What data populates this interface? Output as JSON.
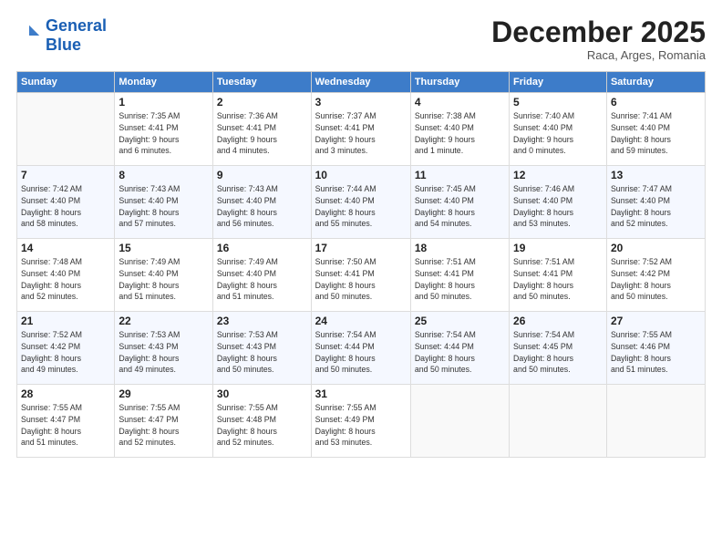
{
  "header": {
    "logo_line1": "General",
    "logo_line2": "Blue",
    "month": "December 2025",
    "location": "Raca, Arges, Romania"
  },
  "days_header": [
    "Sunday",
    "Monday",
    "Tuesday",
    "Wednesday",
    "Thursday",
    "Friday",
    "Saturday"
  ],
  "weeks": [
    [
      {
        "day": "",
        "info": ""
      },
      {
        "day": "1",
        "info": "Sunrise: 7:35 AM\nSunset: 4:41 PM\nDaylight: 9 hours\nand 6 minutes."
      },
      {
        "day": "2",
        "info": "Sunrise: 7:36 AM\nSunset: 4:41 PM\nDaylight: 9 hours\nand 4 minutes."
      },
      {
        "day": "3",
        "info": "Sunrise: 7:37 AM\nSunset: 4:41 PM\nDaylight: 9 hours\nand 3 minutes."
      },
      {
        "day": "4",
        "info": "Sunrise: 7:38 AM\nSunset: 4:40 PM\nDaylight: 9 hours\nand 1 minute."
      },
      {
        "day": "5",
        "info": "Sunrise: 7:40 AM\nSunset: 4:40 PM\nDaylight: 9 hours\nand 0 minutes."
      },
      {
        "day": "6",
        "info": "Sunrise: 7:41 AM\nSunset: 4:40 PM\nDaylight: 8 hours\nand 59 minutes."
      }
    ],
    [
      {
        "day": "7",
        "info": "Sunrise: 7:42 AM\nSunset: 4:40 PM\nDaylight: 8 hours\nand 58 minutes."
      },
      {
        "day": "8",
        "info": "Sunrise: 7:43 AM\nSunset: 4:40 PM\nDaylight: 8 hours\nand 57 minutes."
      },
      {
        "day": "9",
        "info": "Sunrise: 7:43 AM\nSunset: 4:40 PM\nDaylight: 8 hours\nand 56 minutes."
      },
      {
        "day": "10",
        "info": "Sunrise: 7:44 AM\nSunset: 4:40 PM\nDaylight: 8 hours\nand 55 minutes."
      },
      {
        "day": "11",
        "info": "Sunrise: 7:45 AM\nSunset: 4:40 PM\nDaylight: 8 hours\nand 54 minutes."
      },
      {
        "day": "12",
        "info": "Sunrise: 7:46 AM\nSunset: 4:40 PM\nDaylight: 8 hours\nand 53 minutes."
      },
      {
        "day": "13",
        "info": "Sunrise: 7:47 AM\nSunset: 4:40 PM\nDaylight: 8 hours\nand 52 minutes."
      }
    ],
    [
      {
        "day": "14",
        "info": "Sunrise: 7:48 AM\nSunset: 4:40 PM\nDaylight: 8 hours\nand 52 minutes."
      },
      {
        "day": "15",
        "info": "Sunrise: 7:49 AM\nSunset: 4:40 PM\nDaylight: 8 hours\nand 51 minutes."
      },
      {
        "day": "16",
        "info": "Sunrise: 7:49 AM\nSunset: 4:40 PM\nDaylight: 8 hours\nand 51 minutes."
      },
      {
        "day": "17",
        "info": "Sunrise: 7:50 AM\nSunset: 4:41 PM\nDaylight: 8 hours\nand 50 minutes."
      },
      {
        "day": "18",
        "info": "Sunrise: 7:51 AM\nSunset: 4:41 PM\nDaylight: 8 hours\nand 50 minutes."
      },
      {
        "day": "19",
        "info": "Sunrise: 7:51 AM\nSunset: 4:41 PM\nDaylight: 8 hours\nand 50 minutes."
      },
      {
        "day": "20",
        "info": "Sunrise: 7:52 AM\nSunset: 4:42 PM\nDaylight: 8 hours\nand 50 minutes."
      }
    ],
    [
      {
        "day": "21",
        "info": "Sunrise: 7:52 AM\nSunset: 4:42 PM\nDaylight: 8 hours\nand 49 minutes."
      },
      {
        "day": "22",
        "info": "Sunrise: 7:53 AM\nSunset: 4:43 PM\nDaylight: 8 hours\nand 49 minutes."
      },
      {
        "day": "23",
        "info": "Sunrise: 7:53 AM\nSunset: 4:43 PM\nDaylight: 8 hours\nand 50 minutes."
      },
      {
        "day": "24",
        "info": "Sunrise: 7:54 AM\nSunset: 4:44 PM\nDaylight: 8 hours\nand 50 minutes."
      },
      {
        "day": "25",
        "info": "Sunrise: 7:54 AM\nSunset: 4:44 PM\nDaylight: 8 hours\nand 50 minutes."
      },
      {
        "day": "26",
        "info": "Sunrise: 7:54 AM\nSunset: 4:45 PM\nDaylight: 8 hours\nand 50 minutes."
      },
      {
        "day": "27",
        "info": "Sunrise: 7:55 AM\nSunset: 4:46 PM\nDaylight: 8 hours\nand 51 minutes."
      }
    ],
    [
      {
        "day": "28",
        "info": "Sunrise: 7:55 AM\nSunset: 4:47 PM\nDaylight: 8 hours\nand 51 minutes."
      },
      {
        "day": "29",
        "info": "Sunrise: 7:55 AM\nSunset: 4:47 PM\nDaylight: 8 hours\nand 52 minutes."
      },
      {
        "day": "30",
        "info": "Sunrise: 7:55 AM\nSunset: 4:48 PM\nDaylight: 8 hours\nand 52 minutes."
      },
      {
        "day": "31",
        "info": "Sunrise: 7:55 AM\nSunset: 4:49 PM\nDaylight: 8 hours\nand 53 minutes."
      },
      {
        "day": "",
        "info": ""
      },
      {
        "day": "",
        "info": ""
      },
      {
        "day": "",
        "info": ""
      }
    ]
  ]
}
